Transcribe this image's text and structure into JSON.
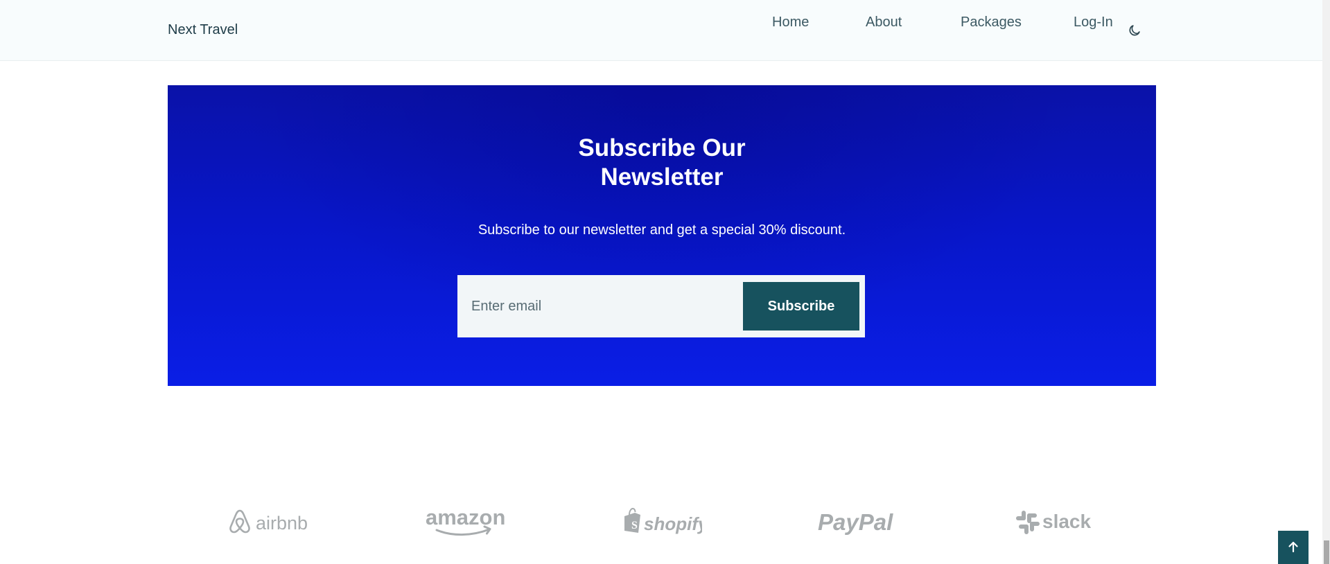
{
  "navbar": {
    "brand": "Next Travel",
    "links": [
      "Home",
      "About",
      "Packages",
      "Log-In"
    ],
    "theme_icon": "moon-icon"
  },
  "newsletter": {
    "title_line1": "Subscribe Our",
    "title_line2": "Newsletter",
    "subtitle": "Subscribe to our newsletter and get a special 30% discount.",
    "email_placeholder": "Enter email",
    "email_value": "",
    "button_label": "Subscribe"
  },
  "partners": {
    "logos": [
      "airbnb",
      "amazon",
      "shopify",
      "PayPal",
      "slack"
    ]
  },
  "back_to_top": {
    "icon": "arrow-up-icon"
  },
  "colors": {
    "accent": "#17525e",
    "banner_blue": "#0816c8",
    "nav_background": "#f8fcfd",
    "logo_gray": "#a8acae"
  }
}
